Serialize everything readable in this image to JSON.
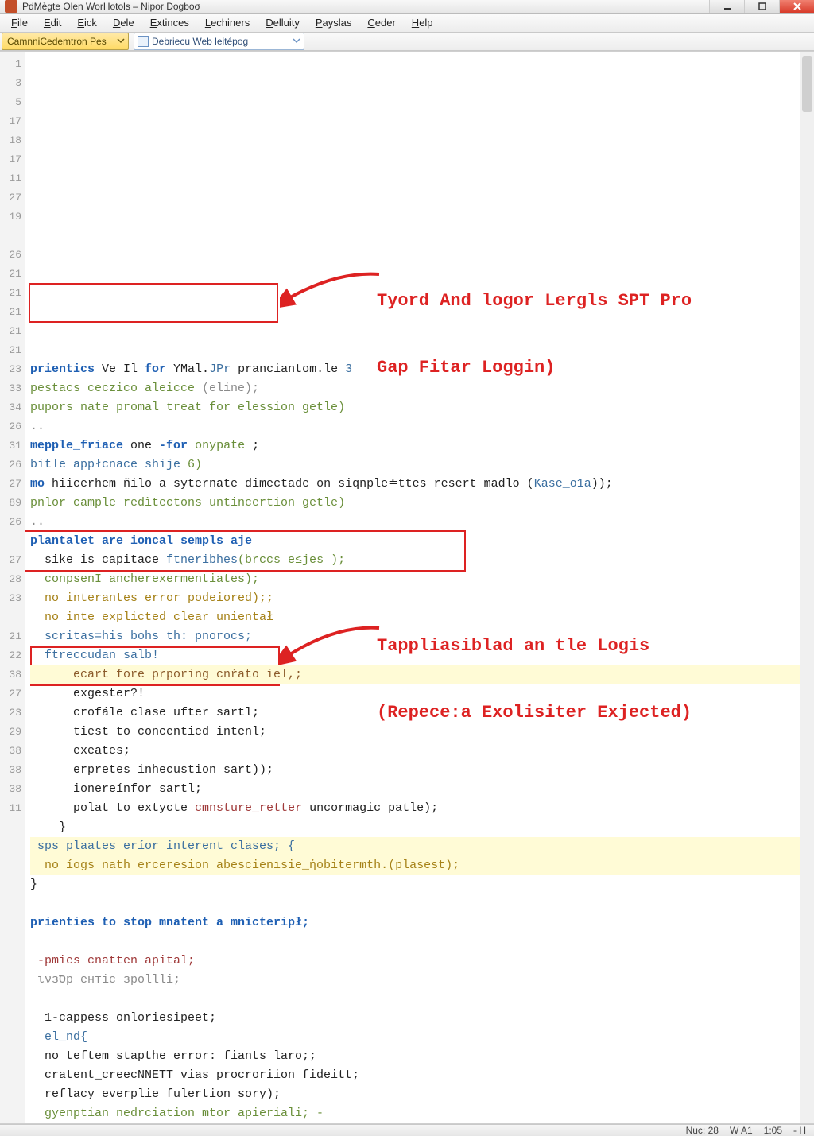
{
  "window": {
    "title": "PdMègte Olen WorHotols – Nipor Dogboσ"
  },
  "menu": [
    {
      "label": "File",
      "mn": "F"
    },
    {
      "label": "Edit",
      "mn": "E"
    },
    {
      "label": "Eick",
      "mn": "E"
    },
    {
      "label": "Dele",
      "mn": "D"
    },
    {
      "label": "Extinces",
      "mn": "E"
    },
    {
      "label": "Lechiners",
      "mn": "L"
    },
    {
      "label": "Delluity",
      "mn": "D"
    },
    {
      "label": "Payslas",
      "mn": "P"
    },
    {
      "label": "Ceder",
      "mn": "C"
    },
    {
      "label": "Help",
      "mn": "H"
    }
  ],
  "toolbar": {
    "combo1": "CamnniCedemtron Pes",
    "combo2": "Debriecu Web leitépog"
  },
  "gutter": [
    "1",
    "3",
    "5",
    "17",
    "18",
    "17",
    "11",
    "27",
    "19",
    "",
    "26",
    "21",
    "21",
    "21",
    "21",
    "21",
    "23",
    "33",
    "34",
    "26",
    "31",
    "26",
    "27",
    "89",
    "26",
    "",
    "27",
    "28",
    "23",
    "",
    "21",
    "22",
    "38",
    "27",
    "23",
    "29",
    "38",
    "38",
    "38",
    "11"
  ],
  "code": [
    [
      {
        "t": "prientics",
        "c": "kw"
      },
      {
        "t": " Ve Il "
      },
      {
        "t": "for",
        "c": "kw"
      },
      {
        "t": " YMal."
      },
      {
        "t": "JPr",
        "c": "typ"
      },
      {
        "t": " pranciantom.le "
      },
      {
        "t": "3",
        "c": "typ"
      }
    ],
    [
      {
        "t": "pestacs ceczico aleicce ",
        "c": "str"
      },
      {
        "t": "(eline);",
        "c": "cm"
      }
    ],
    [
      {
        "t": "pupors nate promal treat for elession getle)",
        "c": "str"
      }
    ],
    [
      {
        "t": "..",
        "c": "cm"
      }
    ],
    [
      {
        "t": "mepple_friace",
        "c": "kw"
      },
      {
        "t": " one "
      },
      {
        "t": "-for",
        "c": "kw"
      },
      {
        "t": " onypate ",
        "c": "str"
      },
      {
        "t": ";"
      }
    ],
    [
      {
        "t": "bitle appłcnace shije ",
        "c": "typ"
      },
      {
        "t": "6)",
        "c": "str"
      }
    ],
    [
      {
        "t": "mo",
        "c": "kw"
      },
      {
        "t": " hiicerhem ñilo a syternate dimectade on siqnple≐ttes resert madlo ("
      },
      {
        "t": "Kase_ō1a",
        "c": "typ"
      },
      {
        "t": "));"
      }
    ],
    [
      {
        "t": "pnlor cample redìtectons untincertion getle)",
        "c": "str"
      }
    ],
    [
      {
        "t": "..",
        "c": "cm"
      }
    ],
    [
      {
        "t": "plantalet are ioncal sempls aje",
        "c": "kw"
      }
    ],
    [
      {
        "t": "  sike is capitace "
      },
      {
        "t": "ftneribhes",
        "c": "typ"
      },
      {
        "t": "(brccs e≤jes );",
        "c": "str"
      }
    ],
    [
      {
        "t": "  conpsenI ancherexermentiates);",
        "c": "str"
      }
    ],
    [
      {
        "t": "  no interantes error podeiored);;",
        "c": "gold"
      }
    ],
    [
      {
        "t": "  no inte explicted clear unientał",
        "c": "gold"
      }
    ],
    [
      {
        "t": "  scritas=his bohs th: pnorocs;",
        "c": "typ"
      }
    ],
    [
      {
        "t": "  ftreccudan salb!",
        "c": "typ"
      }
    ],
    [
      {
        "t": "      ecart fore prporing cnŕato iel,;",
        "c": "brown"
      }
    ],
    [
      {
        "t": "      exgester?!",
        "c": ""
      }
    ],
    [
      {
        "t": "      crofále clase ufter sartl;",
        "c": ""
      }
    ],
    [
      {
        "t": "      tiest to concentied intenl;",
        "c": ""
      }
    ],
    [
      {
        "t": "      exeates;",
        "c": ""
      }
    ],
    [
      {
        "t": "      erpretes inhecustion sart));",
        "c": ""
      }
    ],
    [
      {
        "t": "      ionereínfor sartl;",
        "c": ""
      }
    ],
    [
      {
        "t": "      polat to extycte "
      },
      {
        "t": "cmnsture_retter",
        "c": "err"
      },
      {
        "t": " uncormagic patle);"
      }
    ],
    [
      {
        "t": "    }"
      }
    ],
    [
      {
        "t": " sps plaates eríor interent clases; {",
        "c": "typ"
      }
    ],
    [
      {
        "t": "  no íogs nath erceresion abescienısie_ἡobitermth.(plasest);",
        "c": "gold"
      }
    ],
    [
      {
        "t": "}"
      }
    ],
    [
      {
        "t": ""
      }
    ],
    [
      {
        "t": "prienties to stop mnatent a mnicteripł;",
        "c": "kw"
      }
    ],
    [
      {
        "t": ""
      }
    ],
    [
      {
        "t": " -pmies cnatten apital;",
        "c": "err"
      }
    ],
    [
      {
        "t": " ινзסр ентіс зроllli;",
        "c": "cm"
      }
    ],
    [
      {
        "t": ""
      }
    ],
    [
      {
        "t": "  1-cappess onloriesipeet;"
      }
    ],
    [
      {
        "t": "  el_nd{",
        "c": "typ"
      }
    ],
    [
      {
        "t": "  no teftem stapthe error: fiants laro;;"
      }
    ],
    [
      {
        "t": "  cratent_creecNNETT vias procroriion fideitt;"
      }
    ],
    [
      {
        "t": "  reflacy everplie fulertion sory);"
      }
    ],
    [
      {
        "t": "  gyenptian nedrciation mtor apieriali; -",
        "c": "str"
      }
    ]
  ],
  "callouts": {
    "c1_l1": "Tyord And logor Lergls SPT Pro",
    "c1_l2": "Gap Fitar Loggin)",
    "c2_l1": "Tappliasiblad an tle Logis",
    "c2_l2": "(Repece:a Exolisiter Exjected)"
  },
  "status": {
    "line": "Nuc: 28",
    "col": "W A1",
    "time": "1:05",
    "end": "- H"
  }
}
